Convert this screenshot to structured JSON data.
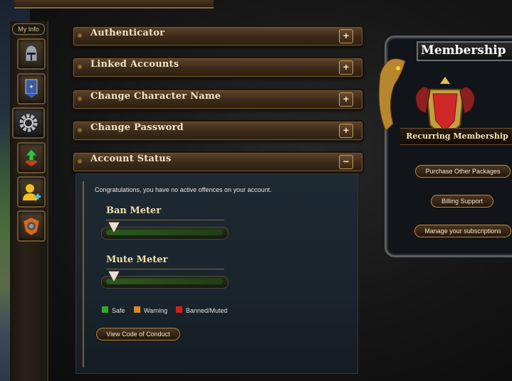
{
  "sidebar": {
    "my_info_label": "My Info",
    "items": [
      {
        "icon": "helmet-icon"
      },
      {
        "icon": "banner-icon"
      },
      {
        "icon": "gear-icon",
        "active": true
      },
      {
        "icon": "upgrade-arrow-icon"
      },
      {
        "icon": "add-user-icon"
      },
      {
        "icon": "shield-badge-icon"
      }
    ]
  },
  "sections": [
    {
      "label": "Authenticator",
      "toggle": "+"
    },
    {
      "label": "Linked Accounts",
      "toggle": "+"
    },
    {
      "label": "Change Character Name",
      "toggle": "+"
    },
    {
      "label": "Change Password",
      "toggle": "+"
    },
    {
      "label": "Account Status",
      "toggle": "−"
    }
  ],
  "account_status": {
    "message": "Congratulations, you have no active offences on your account.",
    "ban_meter": {
      "title": "Ban Meter",
      "level": 0
    },
    "mute_meter": {
      "title": "Mute Meter",
      "level": 0
    },
    "legend": [
      {
        "label": "Safe",
        "color": "#2faa2a"
      },
      {
        "label": "Warning",
        "color": "#d98a1e"
      },
      {
        "label": "Banned/Muted",
        "color": "#d22020"
      }
    ],
    "conduct_button": "View Code of Conduct"
  },
  "membership": {
    "title": "Membership",
    "subtitle": "Recurring Membership",
    "buttons": [
      "Purchase Other Packages",
      "Billing Support",
      "Manage your subscriptions"
    ]
  },
  "colors": {
    "accent_gold": "#c8a060",
    "panel_bg": "#1e2a33"
  }
}
